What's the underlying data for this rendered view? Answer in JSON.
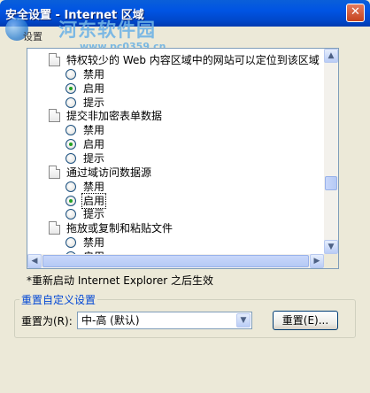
{
  "window": {
    "title": "安全设置 - Internet 区域",
    "close_glyph": "✕"
  },
  "watermark": {
    "name": "河东软件园",
    "url": "www.pc0359.cn",
    "sub": "设置"
  },
  "settings_list": {
    "rows": [
      {
        "kind": "category",
        "label": "特权较少的 Web 内容区域中的网站可以定位到该区域"
      },
      {
        "kind": "option",
        "label": "禁用",
        "checked": false
      },
      {
        "kind": "option",
        "label": "启用",
        "checked": true
      },
      {
        "kind": "option",
        "label": "提示",
        "checked": false
      },
      {
        "kind": "category",
        "label": "提交非加密表单数据"
      },
      {
        "kind": "option",
        "label": "禁用",
        "checked": false
      },
      {
        "kind": "option",
        "label": "启用",
        "checked": true
      },
      {
        "kind": "option",
        "label": "提示",
        "checked": false
      },
      {
        "kind": "category",
        "label": "通过域访问数据源"
      },
      {
        "kind": "option",
        "label": "禁用",
        "checked": false
      },
      {
        "kind": "option",
        "label": "启用",
        "checked": true,
        "focused": true
      },
      {
        "kind": "option",
        "label": "提示",
        "checked": false
      },
      {
        "kind": "category",
        "label": "拖放或复制和粘贴文件"
      },
      {
        "kind": "option",
        "label": "禁用",
        "checked": false
      },
      {
        "kind": "option",
        "label": "启用",
        "checked": true
      }
    ],
    "scroll_up_glyph": "▲",
    "scroll_down_glyph": "▼",
    "scroll_left_glyph": "◀",
    "scroll_right_glyph": "▶"
  },
  "note": "*重新启动 Internet Explorer 之后生效",
  "reset_group": {
    "legend": "重置自定义设置",
    "label": "重置为(R):",
    "selected": "中-高 (默认)",
    "dropdown_glyph": "▼",
    "reset_button": "重置(E)..."
  }
}
